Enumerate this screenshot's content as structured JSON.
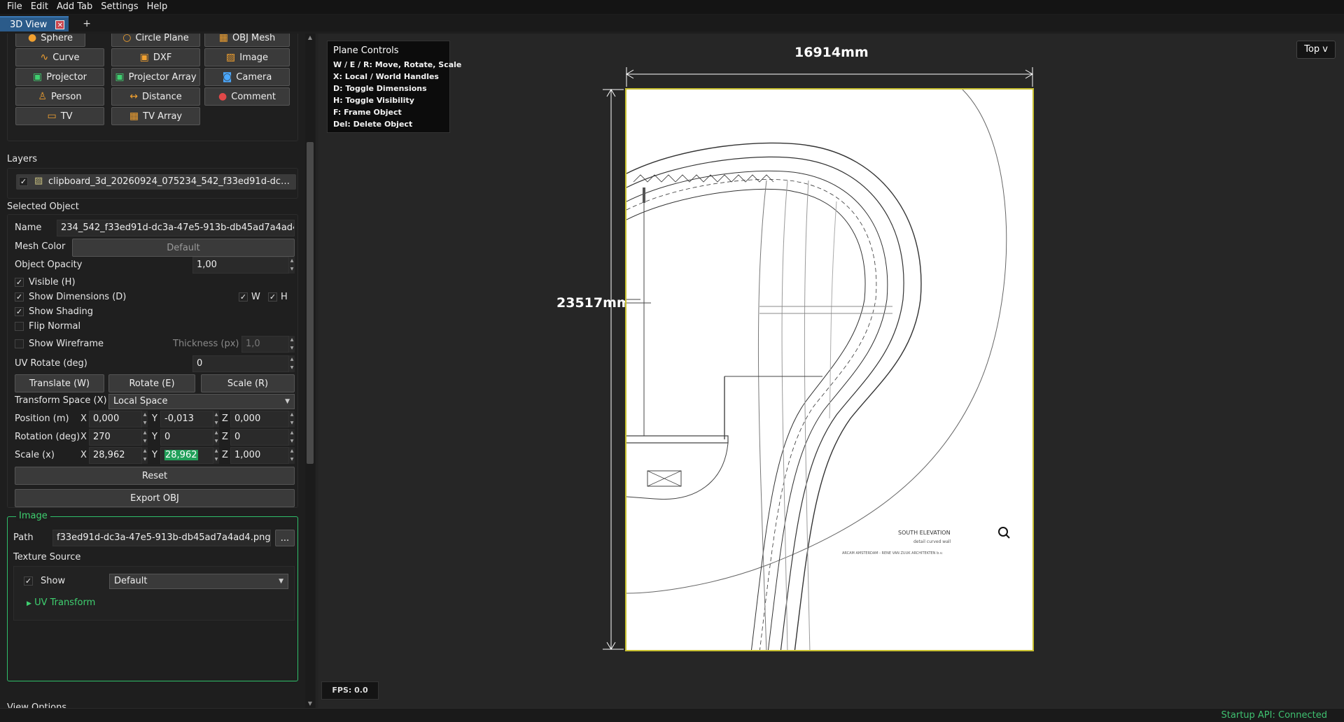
{
  "menu": [
    "File",
    "Edit",
    "Add Tab",
    "Settings",
    "Help"
  ],
  "tabs": {
    "active": "3D View",
    "add": "+"
  },
  "add_buttons": {
    "row0": [
      "Sphere",
      "Circle Plane",
      "OBJ Mesh"
    ],
    "row1": [
      "Curve",
      "DXF",
      "Image"
    ],
    "row2": [
      "Projector",
      "Projector Array",
      "Camera"
    ],
    "row3": [
      "Person",
      "Distance",
      "Comment"
    ],
    "row4": [
      "TV",
      "TV Array"
    ]
  },
  "layers": {
    "title": "Layers",
    "items": [
      {
        "label": "clipboard_3d_20260924_075234_542_f33ed91d-dc…",
        "checked": true
      }
    ]
  },
  "selected": {
    "title": "Selected Object",
    "name_label": "Name",
    "name_value": "234_542_f33ed91d-dc3a-47e5-913b-db45ad7a4ad4",
    "mesh_color_label": "Mesh Color",
    "mesh_color_value": "Default",
    "opacity_label": "Object Opacity",
    "opacity_value": "1,00",
    "visible_label": "Visible (H)",
    "show_dims_label": "Show Dimensions (D)",
    "w_label": "W",
    "h_label": "H",
    "shading_label": "Show Shading",
    "flip_label": "Flip Normal",
    "wireframe_label": "Show Wireframe",
    "thickness_label": "Thickness (px)",
    "thickness_value": "1,0",
    "uv_rotate_label": "UV Rotate (deg)",
    "uv_rotate_value": "0",
    "translate_btn": "Translate (W)",
    "rotate_btn": "Rotate (E)",
    "scale_btn": "Scale (R)",
    "transform_space_label": "Transform Space (X)",
    "transform_space_value": "Local Space",
    "position_label": "Position (m)",
    "position": {
      "x": "0,000",
      "y": "-0,013",
      "z": "0,000"
    },
    "rotation_label": "Rotation (deg)",
    "rotation": {
      "x": "270",
      "y": "0",
      "z": "0"
    },
    "scale_label": "Scale (x)",
    "scale": {
      "x": "28,962",
      "y": "28,962",
      "z": "1,000"
    },
    "axis_x": "X",
    "axis_y": "Y",
    "axis_z": "Z",
    "reset_btn": "Reset",
    "export_btn": "Export OBJ"
  },
  "image": {
    "title": "Image",
    "path_label": "Path",
    "path_value": "f33ed91d-dc3a-47e5-913b-db45ad7a4ad4.png",
    "browse_btn": "...",
    "texture_label": "Texture Source",
    "show_label": "Show",
    "source_value": "Default",
    "uv_transform": "UV Transform",
    "next_section_partial": "View Options"
  },
  "viewport": {
    "plane_controls_title": "Plane Controls",
    "plane_controls_lines": [
      "W / E / R: Move, Rotate, Scale",
      "X: Local / World Handles",
      "D: Toggle Dimensions",
      "H: Toggle Visibility",
      "F: Frame Object",
      "Del: Delete Object"
    ],
    "view_mode": "Top v",
    "fps": "FPS: 0.0",
    "width_dim": "16914mm",
    "height_dim": "23517mm",
    "drawing_caption_1": "SOUTH ELEVATION",
    "drawing_caption_2": "detail curved wall",
    "drawing_caption_3": "ARCAM AMSTERDAM - RENE VAN ZUUK ARCHITEKTEN b.v."
  },
  "status": {
    "text": "Startup API: Connected",
    "color": "#3fc070"
  },
  "colors": {
    "tab_active": "#2b5b8a",
    "accent_green": "#3fd070",
    "frame_yellow": "#c8c030"
  }
}
